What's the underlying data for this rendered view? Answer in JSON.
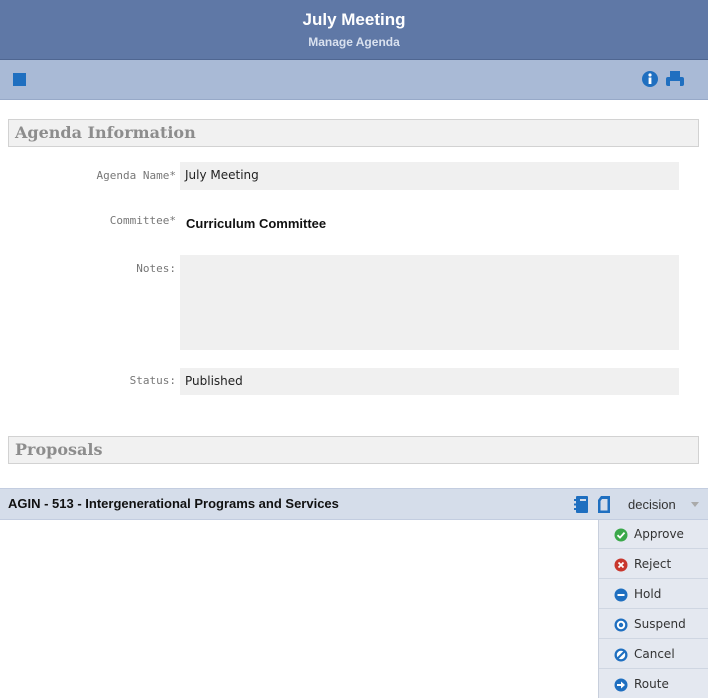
{
  "header": {
    "title": "July Meeting",
    "subtitle": "Manage Agenda"
  },
  "toolbar": {
    "icons": [
      "square-icon",
      "info-icon",
      "print-icon"
    ]
  },
  "agenda_section": {
    "title": "Agenda Information",
    "fields": {
      "agenda_name_label": "Agenda Name*",
      "agenda_name_value": "July Meeting",
      "committee_label": "Committee*",
      "committee_value": "Curriculum Committee",
      "notes_label": "Notes:",
      "notes_value": "",
      "status_label": "Status:",
      "status_value": "Published"
    }
  },
  "proposals_section": {
    "title": "Proposals",
    "items": [
      {
        "title": "AGIN - 513 - Intergenerational Programs and Services",
        "decision_label": "decision"
      }
    ]
  },
  "decision_menu": [
    {
      "label": "Approve",
      "icon": "check-circle-icon"
    },
    {
      "label": "Reject",
      "icon": "x-circle-icon"
    },
    {
      "label": "Hold",
      "icon": "minus-circle-icon"
    },
    {
      "label": "Suspend",
      "icon": "dot-circle-icon"
    },
    {
      "label": "Cancel",
      "icon": "slash-circle-icon"
    },
    {
      "label": "Route",
      "icon": "arrow-circle-icon"
    }
  ],
  "colors": {
    "header_bg": "#5f78a6",
    "toolbar_bg": "#a9bad6",
    "accent_blue": "#1f6fc0",
    "approve_green": "#3aa84a",
    "reject_red": "#c8372d"
  }
}
